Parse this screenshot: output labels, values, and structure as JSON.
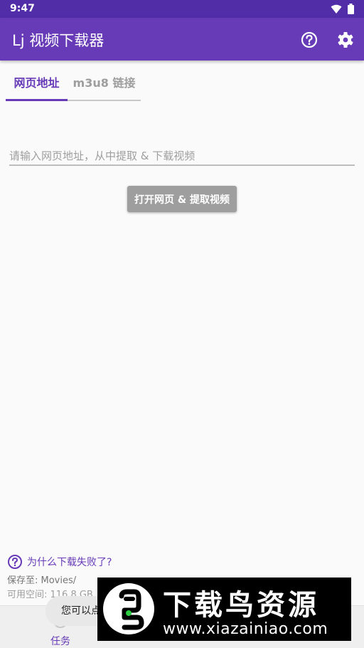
{
  "status_bar": {
    "time": "9:47",
    "icons": [
      "wifi-icon",
      "battery-icon"
    ]
  },
  "app_bar": {
    "title": "Lj 视频下载器",
    "help_icon": "help-circle-icon",
    "settings_icon": "gear-icon"
  },
  "tabs": [
    {
      "label": "网页地址",
      "selected": true
    },
    {
      "label": "m3u8 链接",
      "selected": false
    }
  ],
  "url_input": {
    "placeholder": "请输入网页地址，从中提取 & 下载视频",
    "value": ""
  },
  "open_button": {
    "label": "打开网页 & 提取视频"
  },
  "footer": {
    "fail_link": "为什么下载失败了?",
    "save_to": "保存至: Movies/",
    "free_space": "可用空间: 116.8 GB"
  },
  "bottom_nav": {
    "tasks_label": "任务",
    "tasks_icon": "add-circle-icon"
  },
  "toast": {
    "text": "您可以点"
  },
  "watermark": {
    "title": "下载鸟资源",
    "url": "www.xiazainiao.com"
  },
  "colors": {
    "primary": "#673ab7",
    "primary_dark": "#512da8",
    "button_disabled": "#9e9e9e"
  }
}
